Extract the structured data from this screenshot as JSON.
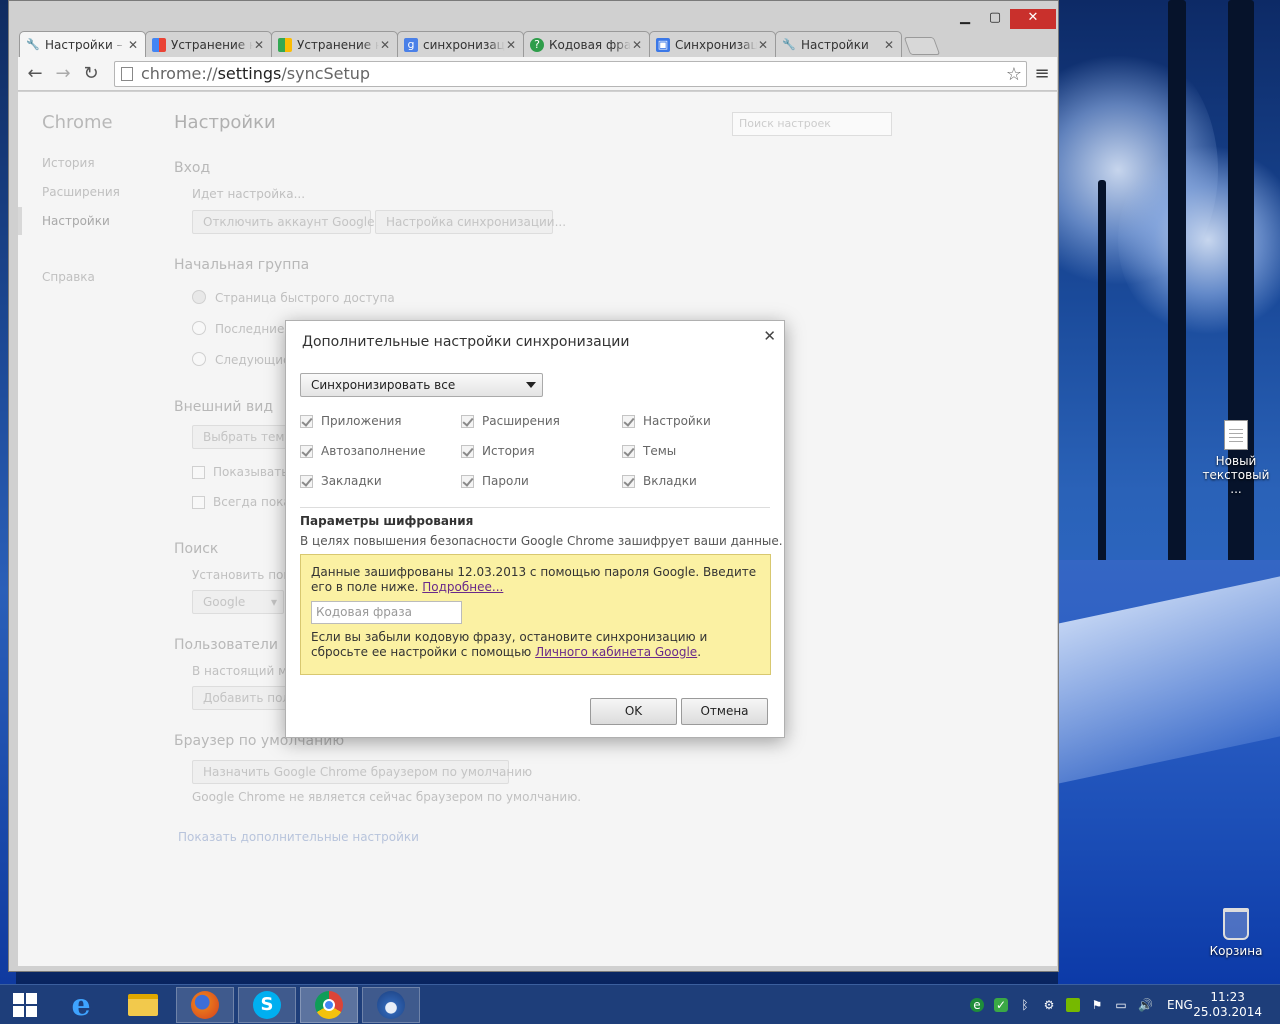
{
  "window": {
    "tabs": [
      {
        "label": "Настройки –",
        "icon": "wrench-icon",
        "active": true
      },
      {
        "label": "Устранение н",
        "icon": "google-icon",
        "active": false
      },
      {
        "label": "Устранение н",
        "icon": "google-icon",
        "active": false
      },
      {
        "label": "синхронизац",
        "icon": "google-g-icon",
        "active": false
      },
      {
        "label": "Кодовая фра",
        "icon": "help-icon",
        "active": false
      },
      {
        "label": "Синхронизац",
        "icon": "support-icon",
        "active": false
      },
      {
        "label": "Настройки",
        "icon": "wrench-icon",
        "active": false
      }
    ],
    "url_scheme": "chrome://",
    "url_host": "settings",
    "url_path": "/syncSetup"
  },
  "settings": {
    "sidebar_title": "Chrome",
    "sidebar_items": [
      "История",
      "Расширения",
      "Настройки",
      "Справка"
    ],
    "title": "Настройки",
    "search_placeholder": "Поиск настроек",
    "signin": {
      "heading": "Вход",
      "status": "Идет настройка...",
      "disconnect_btn": "Отключить аккаунт Google...",
      "sync_btn": "Настройка синхронизации..."
    },
    "startup": {
      "heading": "Начальная группа",
      "opt1": "Страница быстрого доступа",
      "opt2": "Последние о",
      "opt3": "Следующие"
    },
    "appearance": {
      "heading": "Внешний вид",
      "theme_btn": "Выбрать тему",
      "show_home": "Показывать к",
      "always_show": "Всегда показ"
    },
    "search": {
      "heading": "Поиск",
      "text": "Установить поис",
      "engine": "Google"
    },
    "users": {
      "heading": "Пользователи",
      "text": "В настоящий мом",
      "add_btn": "Добавить поль"
    },
    "default_browser": {
      "heading": "Браузер по умолчанию",
      "btn": "Назначить Google Chrome браузером по умолчанию",
      "text": "Google Chrome не является сейчас браузером по умолчанию."
    },
    "advanced_link": "Показать дополнительные настройки"
  },
  "dialog": {
    "title": "Дополнительные настройки синхронизации",
    "sync_mode": "Синхронизировать все",
    "options": [
      [
        "Приложения",
        "Расширения",
        "Настройки"
      ],
      [
        "Автозаполнение",
        "История",
        "Темы"
      ],
      [
        "Закладки",
        "Пароли",
        "Вкладки"
      ]
    ],
    "encryption_heading": "Параметры шифрования",
    "encryption_text": "В целях повышения безопасности Google Chrome зашифрует ваши данные.",
    "warn_text": "Данные зашифрованы 12.03.2013 с помощью пароля Google. Введите его в поле ниже.",
    "warn_link": "Подробнее...",
    "passphrase_placeholder": "Кодовая фраза",
    "forgot_text": "Если вы забыли кодовую фразу, остановите синхронизацию и сбросьте ее настройки с помощью",
    "forgot_link": "Личного кабинета Google",
    "ok": "OK",
    "cancel": "Отмена"
  },
  "desktop": {
    "icon1": "Новый текстовый ...",
    "icon2": "Корзина"
  },
  "taskbar": {
    "lang": "ENG",
    "time": "11:23",
    "date": "25.03.2014"
  }
}
